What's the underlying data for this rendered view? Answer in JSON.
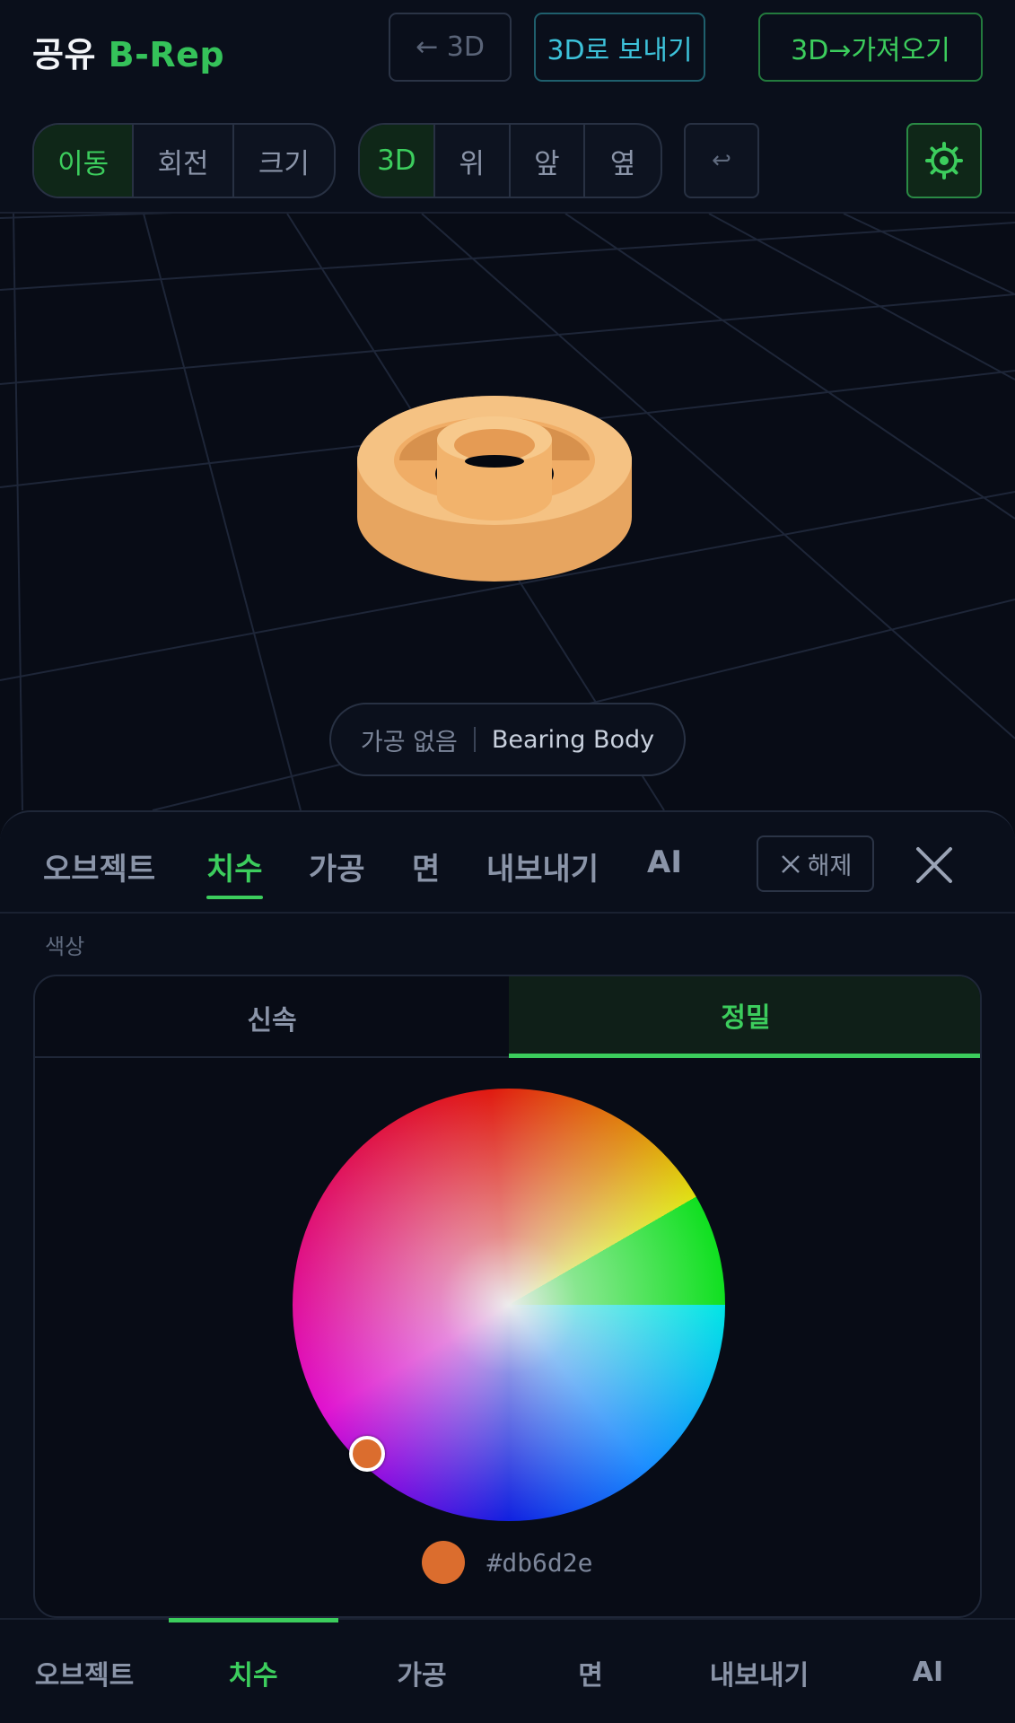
{
  "header": {
    "title_prefix": "공유",
    "title_accent": "B-Rep",
    "back_label": "← 3D",
    "send_label": "3D로 보내기",
    "import_label": "3D→가져오기"
  },
  "toolbar": {
    "transform_modes": [
      "이동",
      "회전",
      "크기"
    ],
    "active_transform": "이동",
    "view_modes": [
      "3D",
      "위",
      "앞",
      "옆"
    ],
    "active_view": "3D",
    "undo_icon": "↩",
    "settings_icon": "gear-icon"
  },
  "viewport": {
    "status_machining": "가공 없음",
    "object_name": "Bearing Body",
    "object_color": "#f5b56a"
  },
  "panel": {
    "tabs": [
      "오브젝트",
      "치수",
      "가공",
      "면",
      "내보내기",
      "AI"
    ],
    "active_tab": "치수",
    "release_label": "해제",
    "section_label": "색상",
    "modes": [
      "신속",
      "정밀"
    ],
    "active_mode": "정밀",
    "color_hex": "#db6d2e"
  },
  "bottom_nav": {
    "items": [
      "오브젝트",
      "치수",
      "가공",
      "면",
      "내보내기",
      "AI"
    ],
    "active": "치수"
  },
  "colors": {
    "accent_green": "#3ccd5d",
    "accent_cyan": "#3dc2da",
    "background": "#080c16"
  }
}
